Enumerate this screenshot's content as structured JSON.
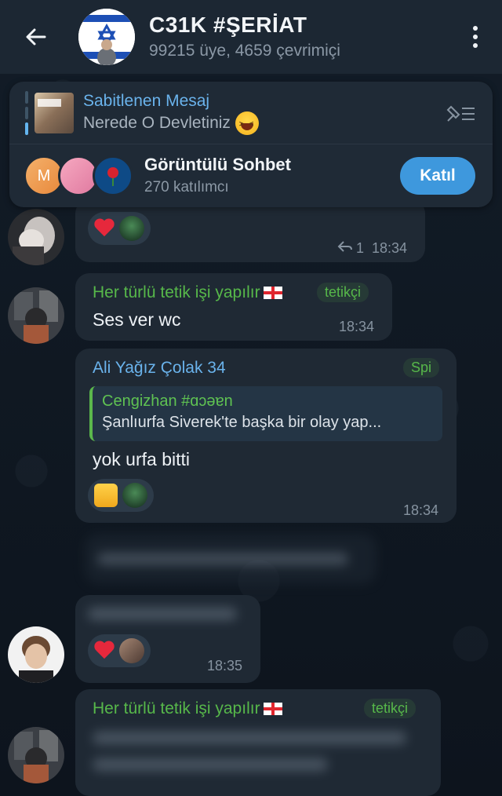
{
  "header": {
    "title": "C31K #ŞERİAT",
    "subtitle": "99215 üye, 4659 çevrimiçi"
  },
  "pinned": {
    "title": "Sabitlenen Mesaj",
    "text": "Nerede O Devletiniz"
  },
  "video_chat": {
    "title": "Görüntülü Sohbet",
    "participants": "270 katılımcı",
    "join_label": "Katıl",
    "first_initial": "M"
  },
  "messages": [
    {
      "reply_count": "1",
      "time": "18:34"
    },
    {
      "sender": "Her türlü tetik işi yapılır",
      "tag": "tetikçi",
      "text": "Ses ver wc",
      "time": "18:34"
    },
    {
      "sender": "Ali Yağız Çolak 34",
      "tag": "Spi",
      "quote_sender": "Cengizhan #ɑɔəɐn",
      "quote_text": "Şanlıurfa Siverek'te başka bir olay yap...",
      "text": "yok urfa bitti",
      "time": "18:34"
    },
    {
      "time": "18:35"
    },
    {
      "sender": "Her türlü tetik işi yapılır",
      "tag": "tetikçi"
    }
  ],
  "colors": {
    "accent": "#64b5ef",
    "sender_green": "#57b84a",
    "sender_blue": "#6ab3ec",
    "join_button": "#3e98dd"
  }
}
